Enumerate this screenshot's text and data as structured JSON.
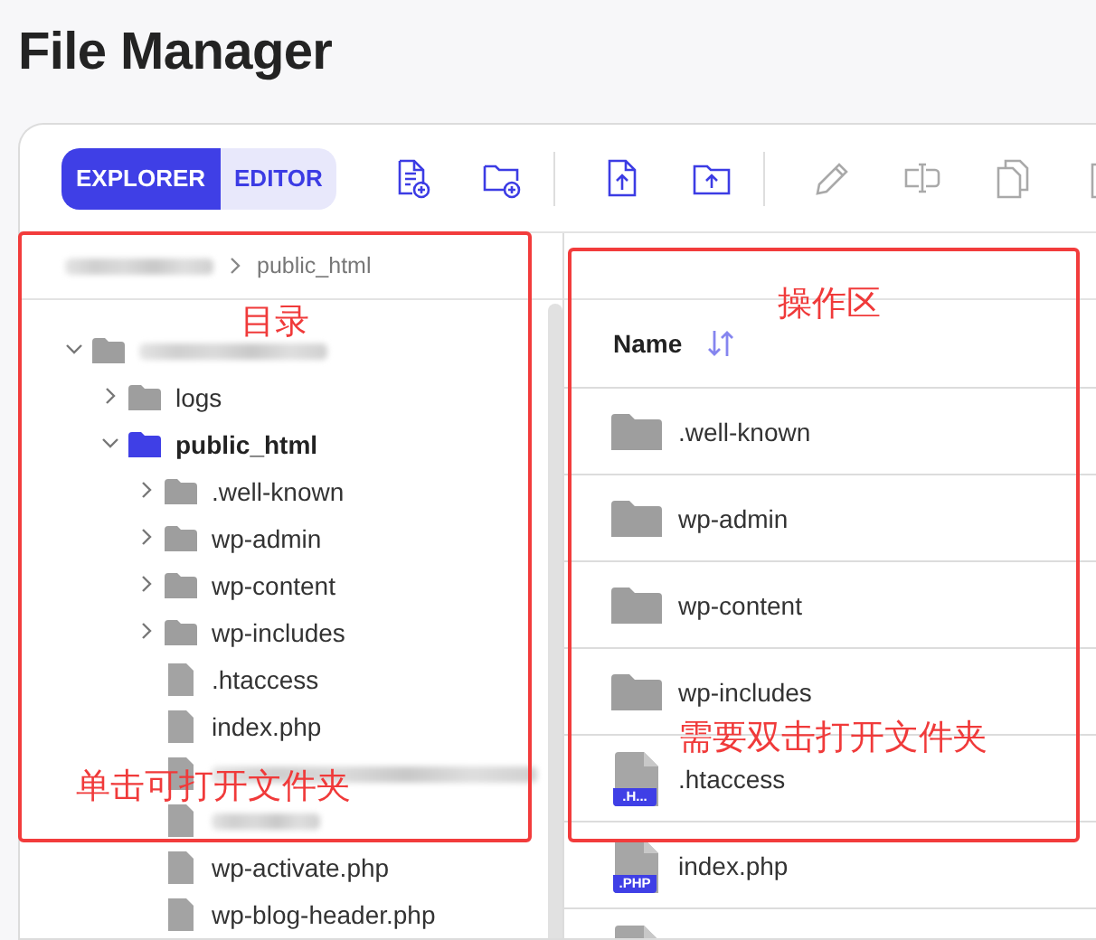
{
  "page": {
    "title": "File Manager"
  },
  "toolbar": {
    "modes": [
      {
        "label": "EXPLORER",
        "selected": true
      },
      {
        "label": "EDITOR",
        "selected": false
      }
    ],
    "action_groups": [
      [
        {
          "kind": "new-file",
          "disabled": false
        },
        {
          "kind": "new-folder",
          "disabled": false
        }
      ],
      [
        {
          "kind": "upload-file",
          "disabled": false
        },
        {
          "kind": "upload-folder",
          "disabled": false
        }
      ],
      [
        {
          "kind": "edit",
          "disabled": true
        },
        {
          "kind": "rename",
          "disabled": true
        },
        {
          "kind": "copy",
          "disabled": true
        },
        {
          "kind": "paste",
          "disabled": true
        }
      ]
    ]
  },
  "breadcrumb": [
    {
      "redacted": true
    },
    {
      "label": "public_html"
    }
  ],
  "tree": [
    {
      "kind": "folder",
      "redacted": true,
      "expanded": true,
      "selected": false,
      "children": [
        {
          "kind": "folder",
          "label": "logs",
          "expanded": false,
          "selected": false
        },
        {
          "kind": "folder",
          "label": "public_html",
          "expanded": true,
          "selected": true,
          "children": [
            {
              "kind": "folder",
              "label": ".well-known",
              "expanded": false,
              "selected": false
            },
            {
              "kind": "folder",
              "label": "wp-admin",
              "expanded": false,
              "selected": false
            },
            {
              "kind": "folder",
              "label": "wp-content",
              "expanded": false,
              "selected": false
            },
            {
              "kind": "folder",
              "label": "wp-includes",
              "expanded": false,
              "selected": false
            },
            {
              "kind": "file",
              "label": ".htaccess",
              "selected": false
            },
            {
              "kind": "file",
              "label": "index.php",
              "selected": false
            },
            {
              "kind": "file",
              "redacted": true,
              "selected": false
            },
            {
              "kind": "file",
              "redacted": true,
              "selected": false
            },
            {
              "kind": "file",
              "label": "wp-activate.php",
              "selected": false
            },
            {
              "kind": "file",
              "label": "wp-blog-header.php",
              "selected": false
            }
          ]
        }
      ]
    }
  ],
  "file_list": {
    "columns": [
      {
        "label": "Name",
        "sortable": true
      }
    ],
    "rows": [
      {
        "kind": "folder",
        "name": ".well-known"
      },
      {
        "kind": "folder",
        "name": "wp-admin"
      },
      {
        "kind": "folder",
        "name": "wp-content"
      },
      {
        "kind": "folder",
        "name": "wp-includes"
      },
      {
        "kind": "file",
        "name": ".htaccess",
        "badge": ".H..."
      },
      {
        "kind": "file",
        "name": "index.php",
        "badge": ".PHP"
      },
      {
        "kind": "file"
      }
    ]
  },
  "annotations": [
    {
      "kind": "tree",
      "title": "目录",
      "note": "单击可打开文件夹"
    },
    {
      "kind": "file_list",
      "title": "操作区",
      "note": "需要双击打开文件夹"
    }
  ]
}
